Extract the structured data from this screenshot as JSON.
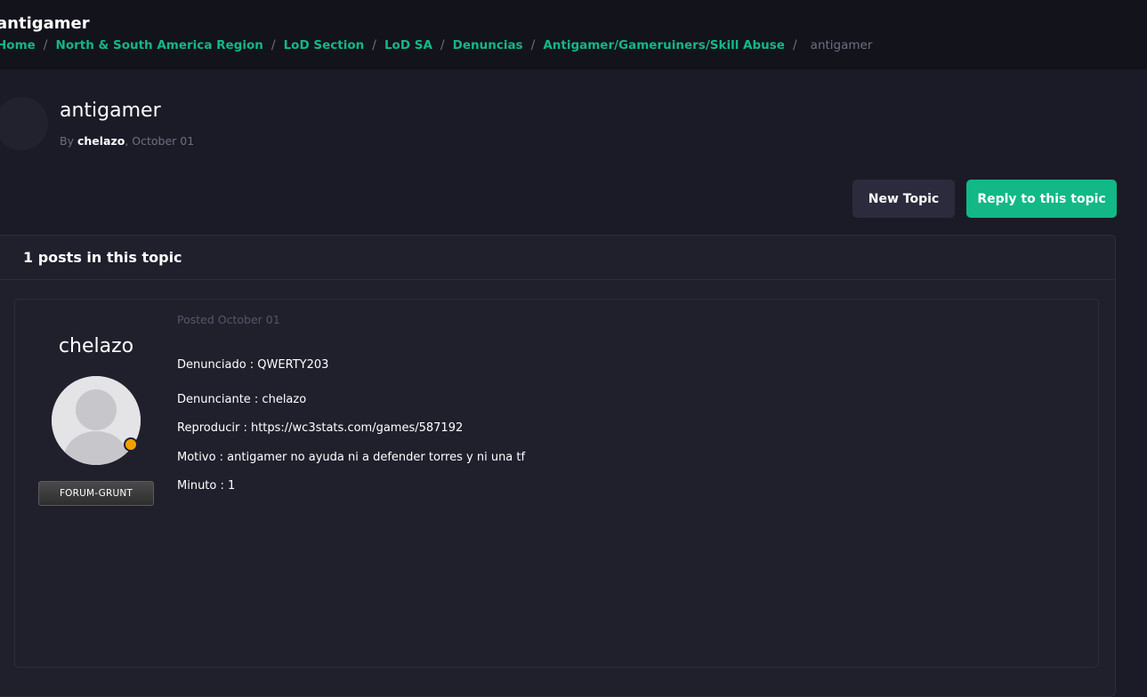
{
  "header": {
    "site_title": "antigamer",
    "breadcrumb": [
      "Home",
      "North & South America Region",
      "LoD Section",
      "LoD SA",
      "Denuncias",
      "Antigamer/Gameruiners/Skill Abuse"
    ],
    "breadcrumb_current": "antigamer"
  },
  "topic": {
    "title": "antigamer",
    "by_label": "By",
    "author": "chelazo",
    "date": ", October 01"
  },
  "actions": {
    "new_topic": "New Topic",
    "reply": "Reply to this topic"
  },
  "posts": {
    "count_label": "1 posts in this topic",
    "items": [
      {
        "author": "chelazo",
        "rank": "FORUM-GRUNT",
        "posted": "Posted October 01",
        "lines": [
          "Denunciado :   QWERTY203",
          "Denunciante :  chelazo",
          "Reproducir : https://wc3stats.com/games/587192",
          "Motivo : antigamer no ayuda ni a defender torres y ni una tf",
          "Minuto : 1"
        ]
      }
    ]
  },
  "colors": {
    "accent": "#12b886",
    "background": "#1b1b27",
    "online_status": "#f59f00"
  }
}
